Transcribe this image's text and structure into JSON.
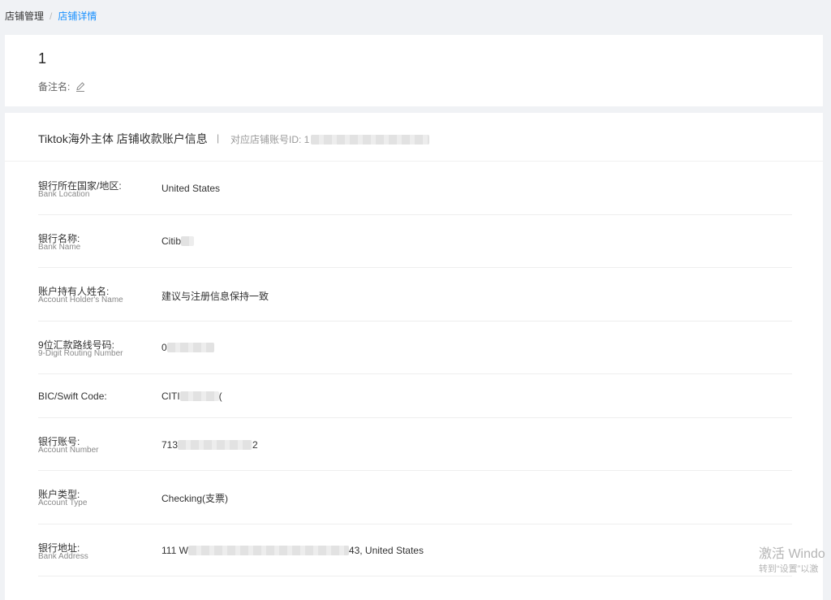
{
  "breadcrumb": {
    "parent": "店铺管理",
    "separator": "/",
    "current": "店铺详情"
  },
  "shop": {
    "name": "1",
    "remark_label": "备注名:"
  },
  "section": {
    "title": "Tiktok海外主体 店铺收款账户信息",
    "divider": "|",
    "account_id_label": "对应店铺账号ID: 1"
  },
  "fields": {
    "bank_location": {
      "cn": "银行所在国家/地区:",
      "en": "Bank Location",
      "value": "United States"
    },
    "bank_name": {
      "cn": "银行名称:",
      "en": "Bank Name",
      "value": "Citib"
    },
    "holder_name": {
      "cn": "账户持有人姓名:",
      "en": "Account Holder's Name",
      "value": "建议与注册信息保持一致"
    },
    "routing_number": {
      "cn": "9位汇款路线号码:",
      "en": "9-Digit Routing Number",
      "value": "0"
    },
    "swift_code": {
      "cn": "BIC/Swift Code:",
      "en": "",
      "value_prefix": "CITI",
      "value_suffix": "("
    },
    "account_number": {
      "cn": "银行账号:",
      "en": "Account Number",
      "value_prefix": "713",
      "value_suffix": "2"
    },
    "account_type": {
      "cn": "账户类型:",
      "en": "Account Type",
      "value": "Checking(支票)"
    },
    "bank_address": {
      "cn": "银行地址:",
      "en": "Bank Address",
      "value_prefix": "111 W",
      "value_suffix": "43, United States"
    }
  },
  "watermark": {
    "line1": "激活 Windo",
    "line2": "转到“设置”以激"
  },
  "icons": {
    "edit": "pencil-icon"
  }
}
